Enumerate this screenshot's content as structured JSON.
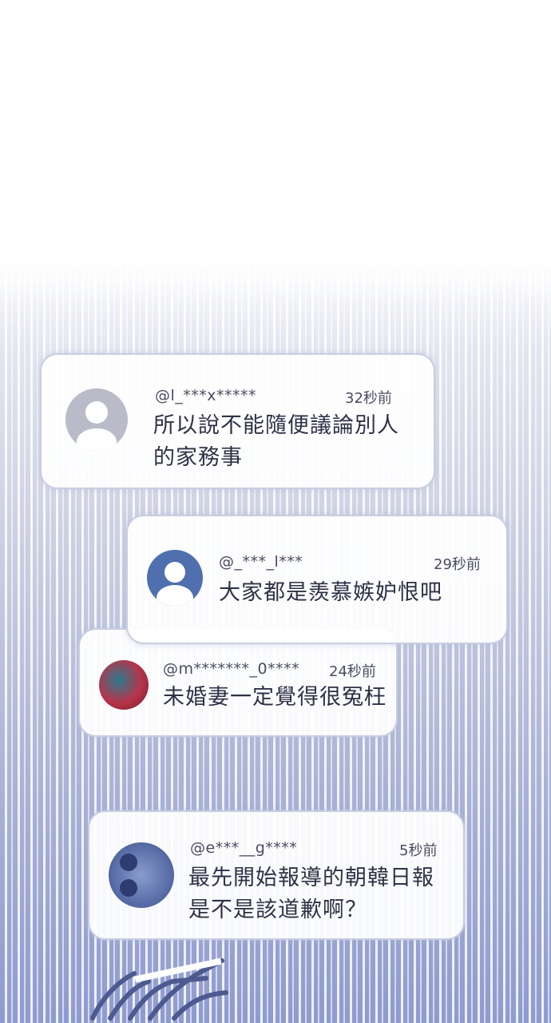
{
  "comments": [
    {
      "user": "@l_***x*****",
      "time": "32秒前",
      "line1": "所以說不能隨便議論別人",
      "line2": "的家務事",
      "avatar_color": "#b9bcc8"
    },
    {
      "user": "@_***_l***",
      "time": "29秒前",
      "line1": "大家都是羨慕嫉妒恨吧",
      "avatar_color": "#4f6fae"
    },
    {
      "user": "@m*******_0****",
      "time": "24秒前",
      "line1": "未婚妻一定覺得很冤枉",
      "avatar_color": "#b8334a"
    },
    {
      "user": "@e***__g****",
      "time": "5秒前",
      "line1": "最先開始報導的朝韓日報",
      "line2": "是不是該道歉啊？",
      "avatar_color": "#5a6ea8"
    }
  ],
  "background": {
    "stripe_base": "#a9b2d6",
    "card_border": "#c9cde0"
  }
}
